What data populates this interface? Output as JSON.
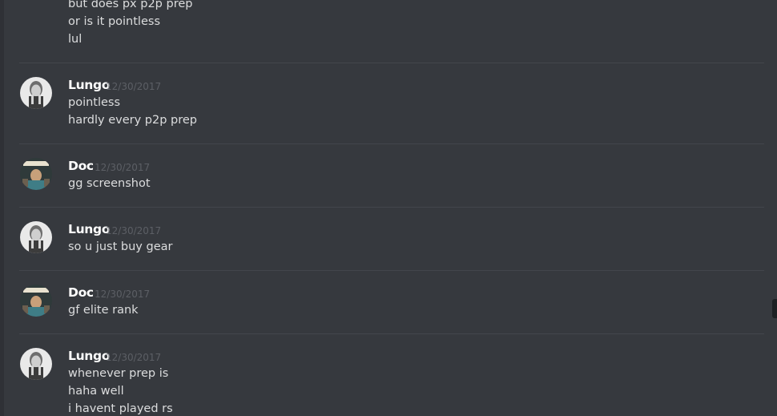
{
  "chat": {
    "top_messages": [
      "but does px p2p prep",
      "or is it pointless",
      "lul"
    ],
    "groups": [
      {
        "author": "Lungo",
        "timestamp": "12/30/2017",
        "avatar": "lungo-avatar",
        "messages": [
          "pointless",
          "hardly every p2p prep"
        ]
      },
      {
        "author": "Doc",
        "timestamp": "12/30/2017",
        "avatar": "doc-avatar",
        "messages": [
          "gg screenshot"
        ]
      },
      {
        "author": "Lungo",
        "timestamp": "12/30/2017",
        "avatar": "lungo-avatar",
        "messages": [
          "so u just buy gear"
        ]
      },
      {
        "author": "Doc",
        "timestamp": "12/30/2017",
        "avatar": "doc-avatar",
        "messages": [
          "gf elite rank"
        ]
      },
      {
        "author": "Lungo",
        "timestamp": "12/30/2017",
        "avatar": "lungo-avatar",
        "messages": [
          "whenever prep is",
          "haha well",
          "i havent played rs"
        ]
      }
    ]
  },
  "colors": {
    "background": "#36393e",
    "username": "#ffffff",
    "message_text": "#dcddde",
    "timestamp": "#5c5f65",
    "divider": "#43464c"
  }
}
